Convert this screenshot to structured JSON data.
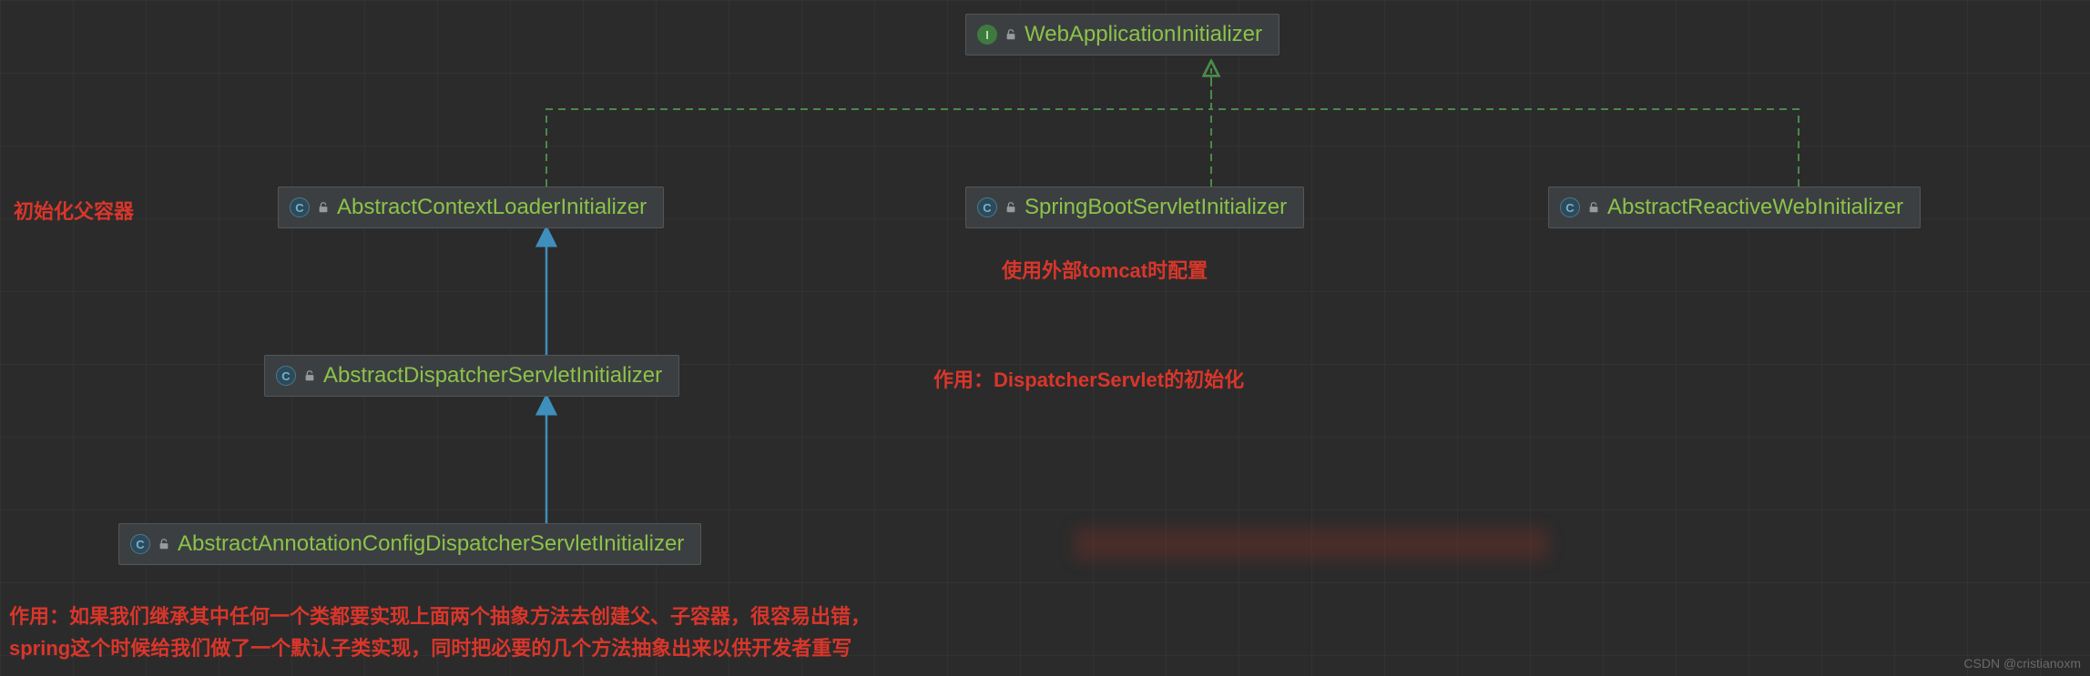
{
  "nodes": {
    "root": {
      "label": "WebApplicationInitializer",
      "icon": "I"
    },
    "ctxLoader": {
      "label": "AbstractContextLoaderInitializer",
      "icon": "C"
    },
    "springBoot": {
      "label": "SpringBootServletInitializer",
      "icon": "C"
    },
    "reactive": {
      "label": "AbstractReactiveWebInitializer",
      "icon": "C"
    },
    "dispatcher": {
      "label": "AbstractDispatcherServletInitializer",
      "icon": "C"
    },
    "annotation": {
      "label": "AbstractAnnotationConfigDispatcherServletInitializer",
      "icon": "C"
    }
  },
  "annotations": {
    "parentContainer": "初始化父容器",
    "externalTomcat": "使用外部tomcat时配置",
    "dispatcherPurpose": "作用：DispatcherServlet的初始化",
    "bottomLine1": "作用：如果我们继承其中任何一个类都要实现上面两个抽象方法去创建父、子容器，很容易出错，",
    "bottomLine2": "spring这个时候给我们做了一个默认子类实现，同时把必要的几个方法抽象出来以供开发者重写"
  },
  "watermark": "CSDN @cristianoxm",
  "colors": {
    "class_text": "#8bc34a",
    "anno": "#d9362b",
    "arrow_solid": "#3e8fbc",
    "arrow_dashed": "#4a8a4a"
  }
}
